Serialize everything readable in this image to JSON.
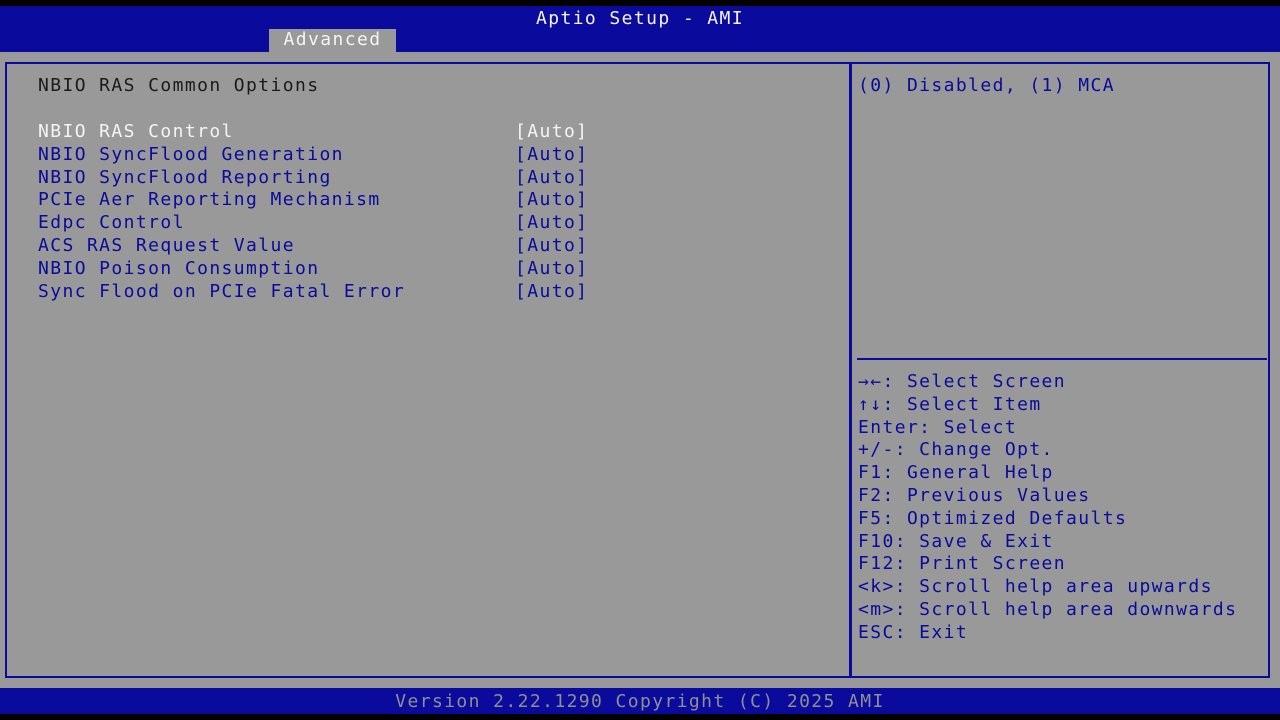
{
  "app": {
    "title": "Aptio Setup - AMI"
  },
  "tabs": [
    {
      "label": "Advanced",
      "active": true
    }
  ],
  "page": {
    "title": "NBIO RAS Common Options"
  },
  "settings": [
    {
      "label": "NBIO RAS Control",
      "value": "[Auto]",
      "selected": true
    },
    {
      "label": "NBIO SyncFlood Generation",
      "value": "[Auto]"
    },
    {
      "label": "NBIO SyncFlood Reporting",
      "value": "[Auto]"
    },
    {
      "label": "PCIe Aer Reporting Mechanism",
      "value": "[Auto]"
    },
    {
      "label": "Edpc Control",
      "value": "[Auto]"
    },
    {
      "label": "ACS RAS Request Value",
      "value": "[Auto]"
    },
    {
      "label": "NBIO Poison Consumption",
      "value": "[Auto]"
    },
    {
      "label": "Sync Flood on PCIe Fatal Error",
      "value": "[Auto]"
    }
  ],
  "help": {
    "text": "(0) Disabled, (1) MCA"
  },
  "keys": [
    "→←: Select Screen",
    "↑↓: Select Item",
    "Enter: Select",
    "+/-: Change Opt.",
    "F1: General Help",
    "F2: Previous Values",
    "F5: Optimized Defaults",
    "F10: Save & Exit",
    "F12: Print Screen",
    "<k>: Scroll help area upwards",
    "<m>: Scroll help area downwards",
    "ESC: Exit"
  ],
  "footer": {
    "text": "Version 2.22.1290 Copyright (C) 2025 AMI"
  },
  "colors": {
    "bios_blue": "#0a0a9c",
    "panel_gray": "#999999",
    "highlight_white": "#f4f4f4"
  }
}
